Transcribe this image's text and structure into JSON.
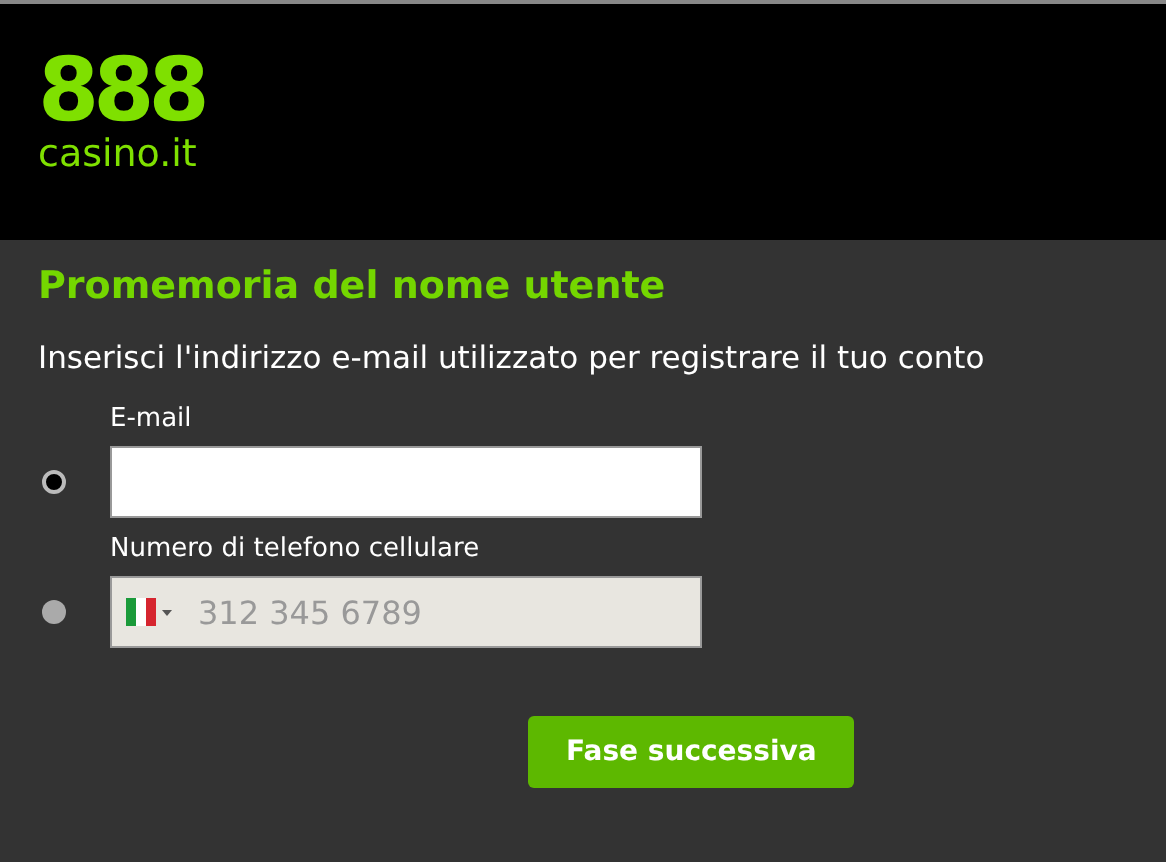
{
  "logo": {
    "mark": "888",
    "domain": "casino.it"
  },
  "title": "Promemoria del nome utente",
  "instruction": "Inserisci l'indirizzo e-mail utilizzato per registrare il tuo conto",
  "options": [
    {
      "kind": "email",
      "label": "E-mail",
      "selected": true,
      "disabled": false
    },
    {
      "kind": "phone",
      "label": "Numero di telefono cellulare",
      "selected": false,
      "disabled": true,
      "placeholder": "312 345 6789"
    }
  ],
  "next_button": "Fase successiva"
}
